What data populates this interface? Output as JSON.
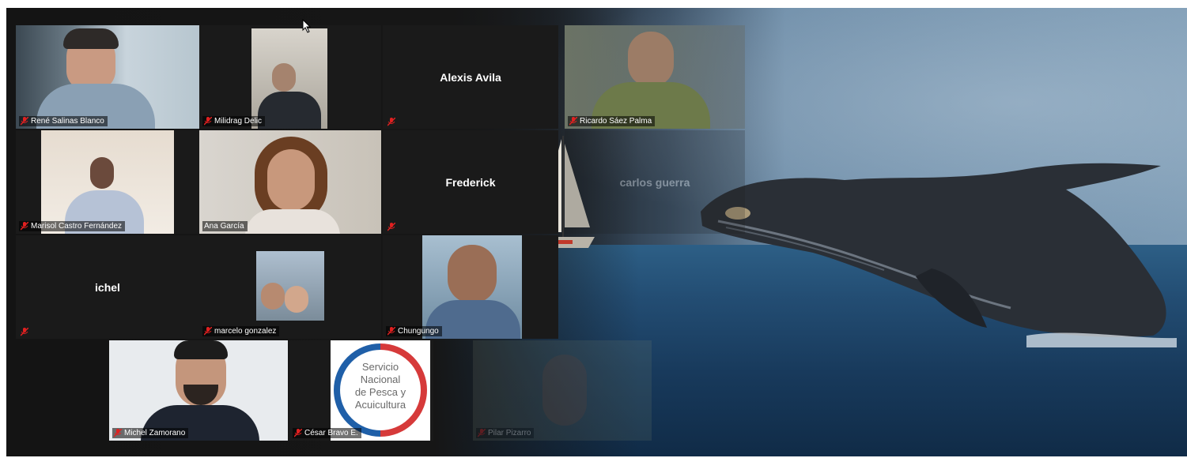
{
  "participants": [
    {
      "name": "René Salinas Blanco"
    },
    {
      "name": "Milidrag Delic"
    },
    {
      "name": "Alexis Avila"
    },
    {
      "name": "Ricardo Sáez Palma"
    },
    {
      "name": "Marisol Castro Fernández"
    },
    {
      "name": "Ana García"
    },
    {
      "name": "Frederick"
    },
    {
      "name": "carlos guerra"
    },
    {
      "name": "ichel"
    },
    {
      "name": "marcelo gonzalez"
    },
    {
      "name": "Chungungo"
    },
    {
      "name": "Michel Zamorano"
    },
    {
      "name": "César Bravo E."
    },
    {
      "name": "Pilar Pizarro"
    }
  ],
  "logo": {
    "line1": "Servicio",
    "line2": "Nacional",
    "line3": "de Pesca y",
    "line4": "Acuicultura"
  },
  "colors": {
    "active_speaker": "#c9e046",
    "mic_muted": "#e02020",
    "tile_bg": "#1a1a1a"
  }
}
